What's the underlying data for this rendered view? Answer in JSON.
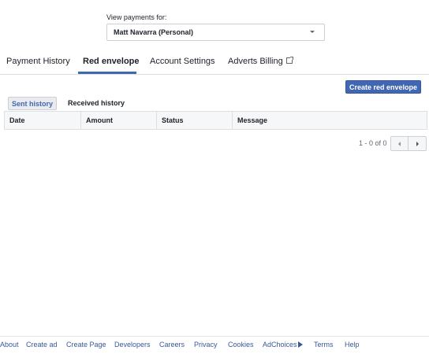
{
  "account": {
    "label": "View payments for:",
    "selected": "Matt Navarra (Personal)"
  },
  "tabs": [
    {
      "label": "Payment History",
      "active": false
    },
    {
      "label": "Red envelope",
      "active": true
    },
    {
      "label": "Account Settings",
      "active": false
    },
    {
      "label": "Adverts Billing",
      "active": false
    }
  ],
  "actions": {
    "create_label": "Create red envelope"
  },
  "subtabs": {
    "sent": "Sent history",
    "received": "Received history"
  },
  "table": {
    "columns": [
      "Date",
      "Amount",
      "Status",
      "Message"
    ]
  },
  "pagination": {
    "range": "1 - 0 of 0"
  },
  "footer": {
    "links": [
      "About",
      "Create ad",
      "Create Page",
      "Developers",
      "Careers",
      "Privacy",
      "Cookies",
      "AdChoices",
      "Terms",
      "Help"
    ]
  },
  "colors": {
    "accent": "#4267b2",
    "link": "#385898"
  }
}
